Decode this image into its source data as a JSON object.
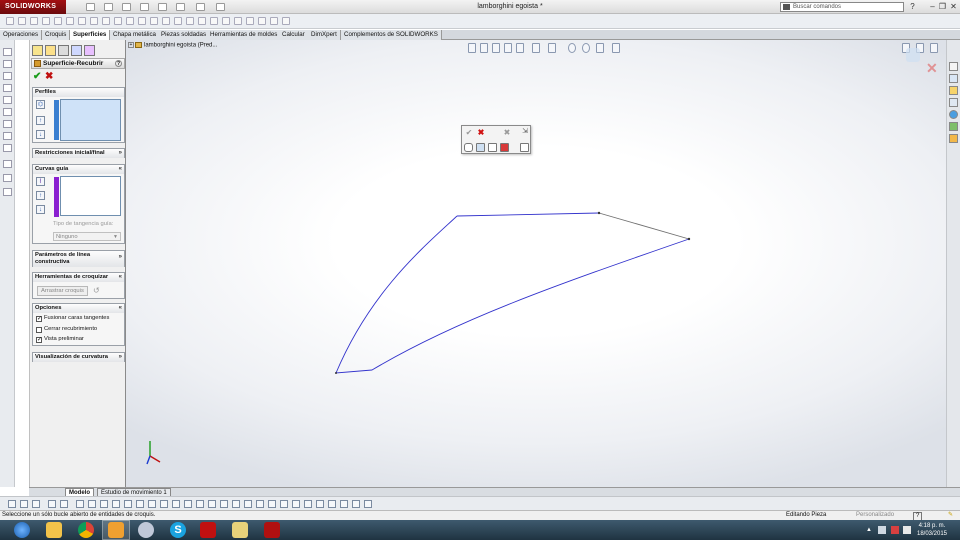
{
  "app": {
    "logo_text": "SOLIDWORKS",
    "document_title": "lamborghini egoista *",
    "search_placeholder": "Buscar comandos"
  },
  "command_tabs": [
    {
      "label": "Operaciones",
      "active": false
    },
    {
      "label": "Croquis",
      "active": false
    },
    {
      "label": "Superficies",
      "active": true
    },
    {
      "label": "Chapa metálica",
      "active": false
    },
    {
      "label": "Piezas soldadas",
      "active": false
    },
    {
      "label": "Herramientas de moldes",
      "active": false
    },
    {
      "label": "Calcular",
      "active": false
    },
    {
      "label": "DimXpert",
      "active": false
    },
    {
      "label": "Complementos de SOLIDWORKS",
      "active": false
    }
  ],
  "property_manager": {
    "title": "Superficie-Recubrir",
    "help": "?",
    "ok_symbol": "✔",
    "cancel_symbol": "✖",
    "groups": {
      "profiles": {
        "title": "Perfiles"
      },
      "constraints": {
        "title": "Restricciones inicial/final"
      },
      "guide_curves": {
        "title": "Curvas guía",
        "tangency_label": "Tipo de tangencia guía:",
        "tangency_value": "Ninguno"
      },
      "centerline": {
        "title": "Parámetros de línea constructiva"
      },
      "sketch_tools": {
        "title": "Herramientas de croquizar",
        "drag_sketch": "Arrastrar croquis"
      },
      "options": {
        "title": "Opciones",
        "merge_tangent": {
          "label": "Fusionar caras tangentes",
          "checked": true
        },
        "close_loft": {
          "label": "Cerrar recubrimiento",
          "checked": false
        },
        "preview": {
          "label": "Vista preliminar",
          "checked": true
        }
      },
      "curvature": {
        "title": "Visualización de curvatura"
      }
    }
  },
  "feature_tree": {
    "root_label": "lamborghini egoista  (Pred..."
  },
  "model_tabs": [
    {
      "label": "Modelo",
      "active": true
    },
    {
      "label": "Estudio de movimiento 1",
      "active": false
    }
  ],
  "status_bar": {
    "message": "Seleccione un sólo bucle abierto de entidades de croquis.",
    "mode": "Editando Pieza",
    "custom": "Personalizado",
    "help": "?"
  },
  "taskbar": {
    "time": "4:18 p. m.",
    "date": "18/03/2015"
  },
  "colors": {
    "profile_bar": "#3a7fd0",
    "guide_bar": "#8a1fd0",
    "sketch_curve": "#3333cc",
    "sketch_gray": "#707070"
  }
}
